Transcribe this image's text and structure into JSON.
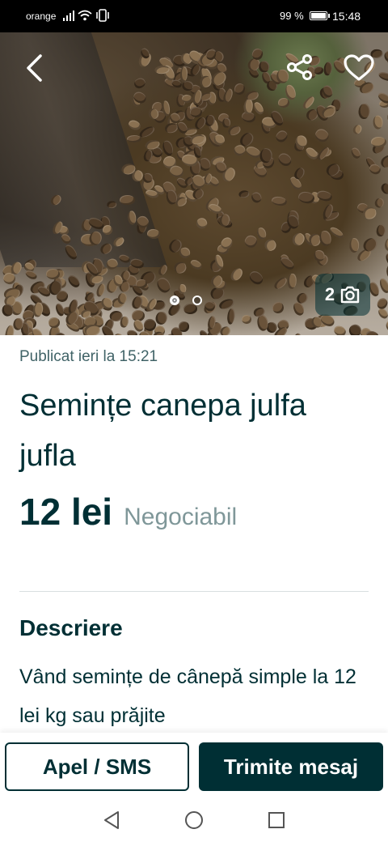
{
  "status_bar": {
    "carrier": "orange",
    "battery_percent": "99 %",
    "battery_level": 0.99,
    "time": "15:48"
  },
  "hero": {
    "photo_count": "2",
    "current_photo": 1
  },
  "listing": {
    "published": "Publicat ieri la 15:21",
    "title": "Semințe canepa julfa jufla",
    "price": "12 lei",
    "negotiable": "Negociabil"
  },
  "description": {
    "heading": "Descriere",
    "text": "Vând semințe de cânepă simple la 12 lei kg sau prăjite"
  },
  "actions": {
    "call_label": "Apel / SMS",
    "message_label": "Trimite mesaj"
  },
  "colors": {
    "primary": "#002f34",
    "muted": "#7f9799",
    "secondary_text": "#406367"
  }
}
